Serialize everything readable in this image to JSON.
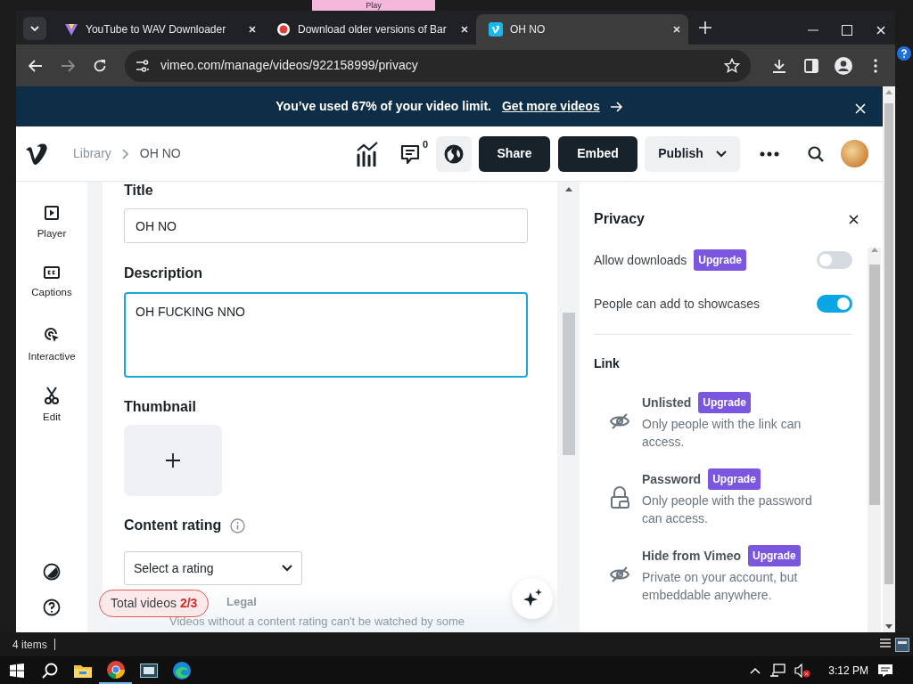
{
  "background_window": {
    "tab": "Play"
  },
  "browser": {
    "tabs": [
      {
        "title": "YouTube to WAV Downloader",
        "kind": "triangle",
        "selected": false
      },
      {
        "title": "Download older versions of Bar",
        "kind": "record",
        "selected": false
      },
      {
        "title": "OH NO",
        "kind": "vimeo",
        "selected": true
      }
    ],
    "address": "vimeo.com/manage/videos/922158999/privacy"
  },
  "banner": {
    "message": "You’ve used 67% of your video limit.",
    "link": "Get more videos"
  },
  "header": {
    "breadcrumb": [
      "Library",
      "OH NO"
    ],
    "comment_count": "0",
    "buttons": [
      "Share",
      "Embed",
      "Publish"
    ]
  },
  "sidebar": {
    "items": [
      {
        "label": "Player",
        "kind": "play"
      },
      {
        "label": "Captions",
        "kind": "cc"
      },
      {
        "label": "Interactive",
        "kind": "pointer"
      },
      {
        "label": "Edit",
        "kind": "scissors"
      }
    ]
  },
  "form": {
    "title": {
      "label": "Title",
      "value": "OH NO"
    },
    "description": {
      "label": "Description",
      "value": "OH FUCKING NNO",
      "focused": true
    },
    "thumbnail": {
      "label": "Thumbnail"
    },
    "content_rating": {
      "label": "Content rating",
      "placeholder": "Select a rating"
    },
    "legal": "Legal",
    "note": "Videos without a content rating can't be watched by some"
  },
  "usage": {
    "label": "Total videos",
    "count": "2/3"
  },
  "privacy": {
    "title": "Privacy",
    "toggles": [
      {
        "label": "Allow downloads",
        "badge": "Upgrade",
        "on": false
      },
      {
        "label": "People can add to showcases",
        "on": true
      }
    ],
    "link_title": "Link",
    "options": [
      {
        "title": "Unlisted",
        "badge": "Upgrade",
        "description": "Only people with the link can access.",
        "kind": "hidden"
      },
      {
        "title": "Password",
        "badge": "Upgrade",
        "description": "Only people with the password can access.",
        "kind": "password"
      },
      {
        "title": "Hide from Vimeo",
        "badge": "Upgrade",
        "description": "Private on your account, but embeddable anywhere.",
        "kind": "hidden"
      }
    ]
  },
  "status_bar": {
    "text": "4 items"
  },
  "taskbar": {
    "time": "3:12 PM"
  }
}
